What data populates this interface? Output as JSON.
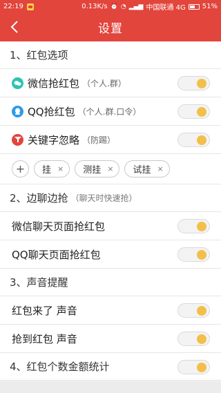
{
  "statusbar": {
    "time": "22:19",
    "speed": "0.13K/s",
    "carrier": "中国联通 4G",
    "battery": "51%"
  },
  "nav": {
    "title": "设置",
    "back_icon": "chevron-left-icon"
  },
  "sections": {
    "redpacket": {
      "title": "1、红包选项"
    },
    "sidechat": {
      "title": "2、边聊边抢",
      "sub": "（聊天时快速抢）"
    },
    "sound": {
      "title": "3、声音提醒"
    },
    "stats": {
      "title": "4、红包个数金额统计"
    }
  },
  "rows": {
    "wechat": {
      "label": "微信抢红包",
      "sub": "（个人.群）",
      "icon": "wechat-icon",
      "color": "#2ec3b3",
      "on": true
    },
    "qq": {
      "label": "QQ抢红包",
      "sub": "（个人.群.口令）",
      "icon": "qq-icon",
      "color": "#2f9be8",
      "on": true
    },
    "keyword": {
      "label": "关键字忽略",
      "sub": "（防踢）",
      "icon": "funnel-icon",
      "color": "#e2453c",
      "on": true
    },
    "wechat_chat": {
      "label": "微信聊天页面抢红包",
      "on": true
    },
    "qq_chat": {
      "label": "QQ聊天页面抢红包",
      "on": true
    },
    "sound_come": {
      "label": "红包来了 声音",
      "on": true
    },
    "sound_got": {
      "label": "抢到红包 声音",
      "on": true
    },
    "stats_toggle": {
      "on": true
    }
  },
  "keywords": {
    "add_label": "+",
    "remove_label": "×",
    "items": [
      "挂",
      "测挂",
      "试挂"
    ]
  },
  "colors": {
    "accent": "#e2453c",
    "toggle_knob": "#f2c04a"
  }
}
